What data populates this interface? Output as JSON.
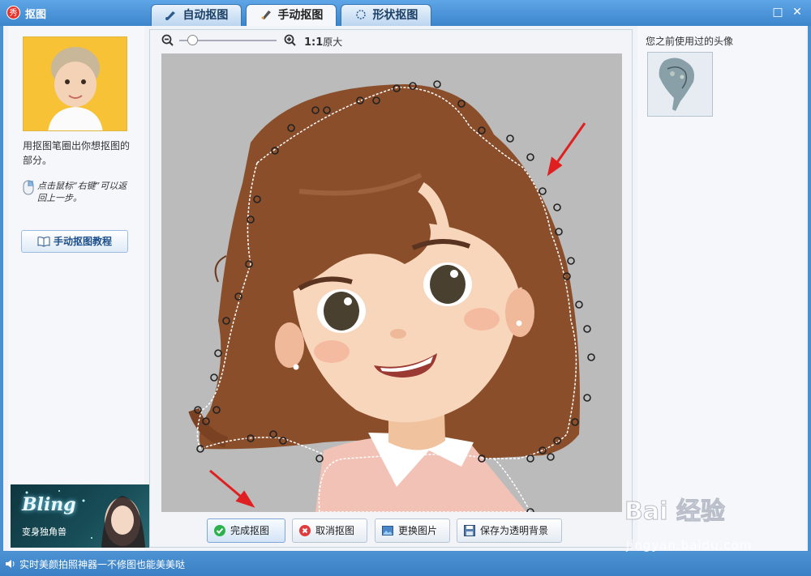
{
  "window": {
    "icon_label": "秀",
    "title": "抠图",
    "maximize_symbol": "□",
    "close_symbol": "✕"
  },
  "tabs": [
    {
      "label": "自动抠图",
      "icon": "brush-icon",
      "active": false
    },
    {
      "label": "手动抠图",
      "icon": "pen-icon",
      "active": true
    },
    {
      "label": "形状抠图",
      "icon": "shape-icon",
      "active": false
    }
  ],
  "left": {
    "hint": "用抠图笔圈出你想抠图的部分。",
    "tip": "点击鼠标“右键”可以返回上一步。",
    "tutorial_button": "手动抠图教程",
    "ad": {
      "title": "Bling",
      "subtitle": "变身独角兽"
    }
  },
  "zoom": {
    "zoom_out_icon": "zoom-out-icon",
    "zoom_in_icon": "zoom-in-icon",
    "ratio": "1:1",
    "ratio_label": "原大",
    "level": 0.1
  },
  "actions": {
    "done": "完成抠图",
    "cancel": "取消抠图",
    "change": "更换图片",
    "save_transparent": "保存为透明背景"
  },
  "right": {
    "history_title": "您之前使用过的头像"
  },
  "status": {
    "icon": "speaker-icon",
    "text": "实时美颜拍照神器一不修图也能美美哒"
  },
  "watermark": {
    "main": "Bai 经验",
    "sub": "jingyan.baidu.com"
  },
  "colors": {
    "accent": "#3d86cc",
    "hair": "#8b4e2b",
    "skin": "#f6d2b4",
    "selection_dots": "#222222"
  }
}
